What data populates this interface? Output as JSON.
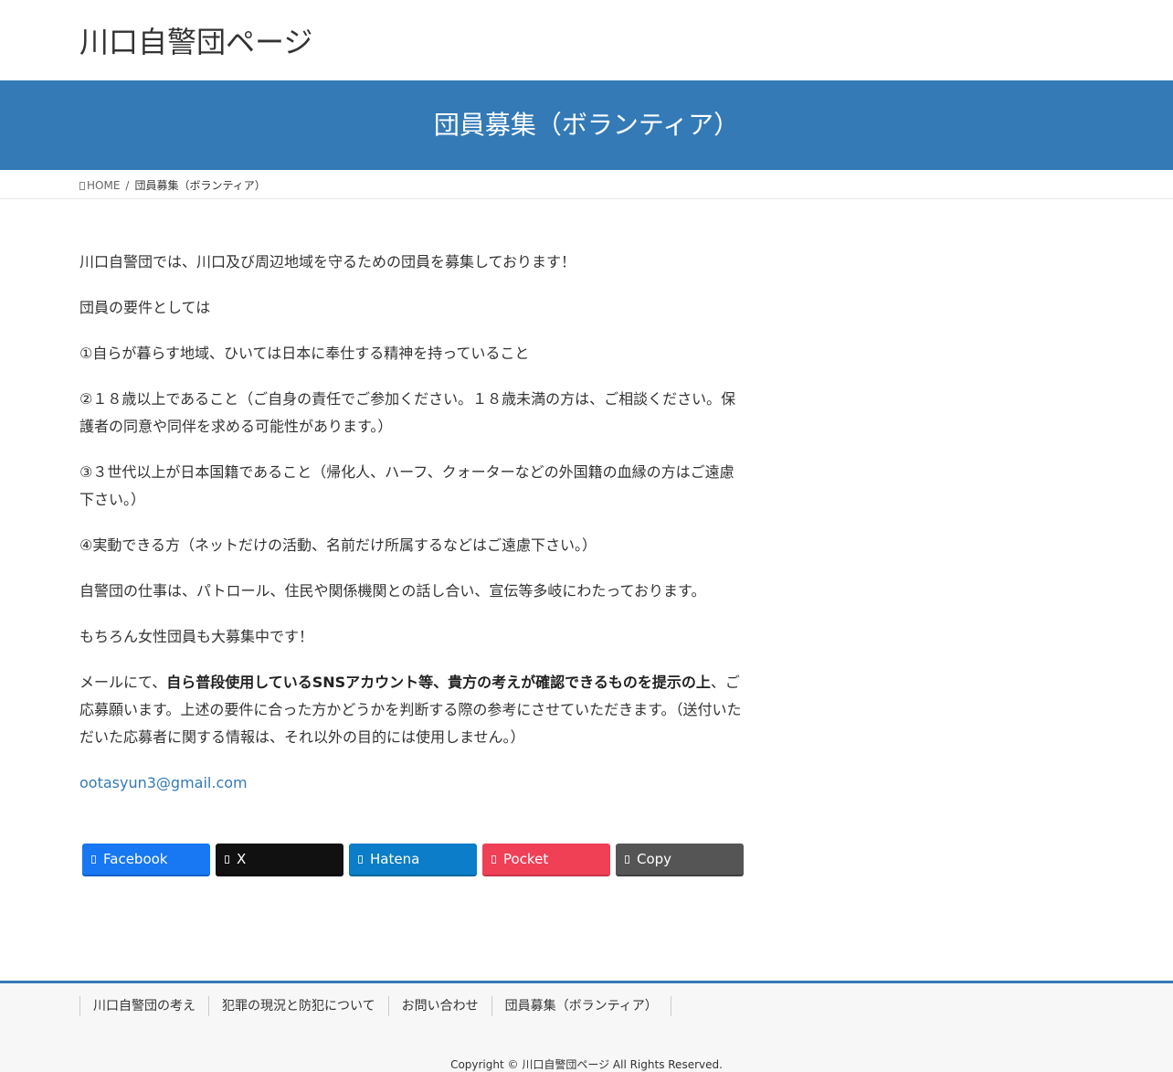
{
  "header": {
    "site_title": "川口自警団ページ"
  },
  "page_header": {
    "title": "団員募集（ボランティア）"
  },
  "breadcrumb": {
    "home_label": "HOME",
    "separator": "/",
    "current": "団員募集（ボランティア）"
  },
  "content": {
    "p1": "川口自警団では、川口及び周辺地域を守るための団員を募集しております！",
    "p2": "団員の要件としては",
    "p3": "①自らが暮らす地域、ひいては日本に奉仕する精神を持っていること",
    "p4": "②１８歳以上であること（ご自身の責任でご参加ください。１８歳未満の方は、ご相談ください。保護者の同意や同伴を求める可能性があります。）",
    "p5": "③３世代以上が日本国籍であること（帰化人、ハーフ、クォーターなどの外国籍の血縁の方はご遠慮下さい。）",
    "p6": "④実動できる方（ネットだけの活動、名前だけ所属するなどはご遠慮下さい。）",
    "p7": "自警団の仕事は、パトロール、住民や関係機関との話し合い、宣伝等多岐にわたっております。",
    "p8": "もちろん女性団員も大募集中です！",
    "p9_pre": "メールにて、",
    "p9_bold": "自ら普段使用しているSNSアカウント等、貴方の考えが確認できるものを提示の上",
    "p9_post": "、ご応募願います。上述の要件に合った方かどうかを判断する際の参考にさせていただきます。（送付いただいた応募者に関する情報は、それ以外の目的には使用しません。）",
    "email": "ootasyun3@gmail.com"
  },
  "share": {
    "facebook": "Facebook",
    "x": "X",
    "hatena": "Hatena",
    "pocket": "Pocket",
    "copy": "Copy"
  },
  "footer": {
    "nav": [
      "川口自警団の考え",
      "犯罪の現況と防犯について",
      "お問い合わせ",
      "団員募集（ボランティア）"
    ],
    "copyright": "Copyright © 川口自警団ページ All Rights Reserved."
  },
  "colors": {
    "brand_blue": "#337ab7",
    "facebook": "#1877f2",
    "x": "#111111",
    "hatena": "#0b7dc9",
    "pocket": "#ef4056",
    "copy": "#555555"
  },
  "icons": [
    "home-icon",
    "facebook-icon",
    "x-icon",
    "hatena-icon",
    "pocket-icon",
    "copy-icon"
  ]
}
